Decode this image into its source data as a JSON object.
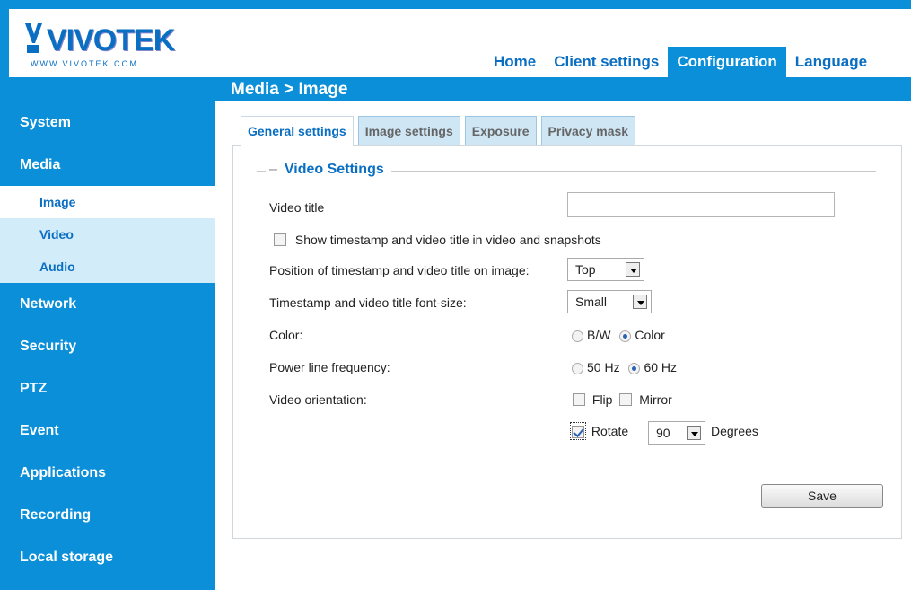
{
  "brand": {
    "name": "VIVOTEK",
    "site": "WWW.VIVOTEK.COM"
  },
  "topnav": {
    "items": [
      "Home",
      "Client settings",
      "Configuration",
      "Language"
    ],
    "active": "Configuration"
  },
  "breadcrumb": "Media  > Image",
  "sidebar": {
    "items": {
      "system": "System",
      "media": "Media",
      "image": "Image",
      "video": "Video",
      "audio": "Audio",
      "network": "Network",
      "security": "Security",
      "ptz": "PTZ",
      "event": "Event",
      "applications": "Applications",
      "recording": "Recording",
      "local_storage": "Local storage"
    }
  },
  "tabs": [
    "General settings",
    "Image settings",
    "Exposure",
    "Privacy mask"
  ],
  "section_title": "Video Settings",
  "form": {
    "video_title_label": "Video title",
    "video_title_value": "",
    "show_timestamp_label": "Show timestamp and video title in video and snapshots",
    "show_timestamp_checked": false,
    "position_label": "Position of timestamp and video title on image:",
    "position_value": "Top",
    "font_size_label": "Timestamp and video title font-size:",
    "font_size_value": "Small",
    "color_label": "Color:",
    "color_options": [
      "B/W",
      "Color"
    ],
    "color_selected": "Color",
    "power_label": "Power line frequency:",
    "power_options": [
      "50 Hz",
      "60 Hz"
    ],
    "power_selected": "60 Hz",
    "orientation_label": "Video orientation:",
    "flip_label": "Flip",
    "mirror_label": "Mirror",
    "rotate_label": "Rotate",
    "rotate_value": "90",
    "degrees_label": "Degrees",
    "save_label": "Save"
  },
  "colors": {
    "accent": "#0a8fd8",
    "link": "#0a6fc2",
    "sub_bg": "#d3ecfa"
  }
}
